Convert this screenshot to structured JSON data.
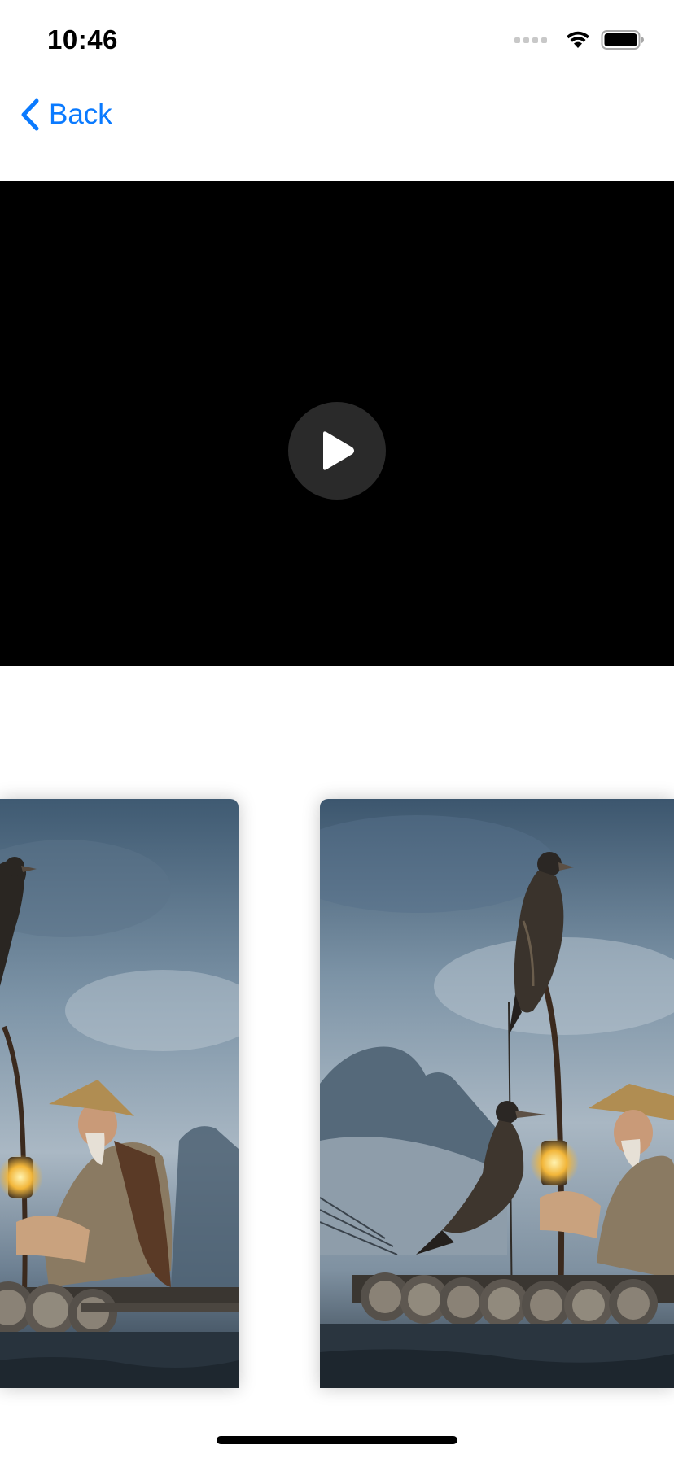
{
  "status_bar": {
    "time": "10:46",
    "icons": [
      "signal-icon",
      "wifi-icon",
      "battery-icon"
    ]
  },
  "nav": {
    "back_label": "Back",
    "back_icon": "chevron-left-icon",
    "accent_color": "#0a7aff"
  },
  "video": {
    "background": "#000000",
    "play_icon": "play-icon"
  },
  "carousel": {
    "items": [
      {
        "image": "fisherman-with-cormorants-photo",
        "position": "partial-left"
      },
      {
        "image": "fisherman-with-cormorants-photo",
        "position": "partial-right"
      }
    ]
  }
}
